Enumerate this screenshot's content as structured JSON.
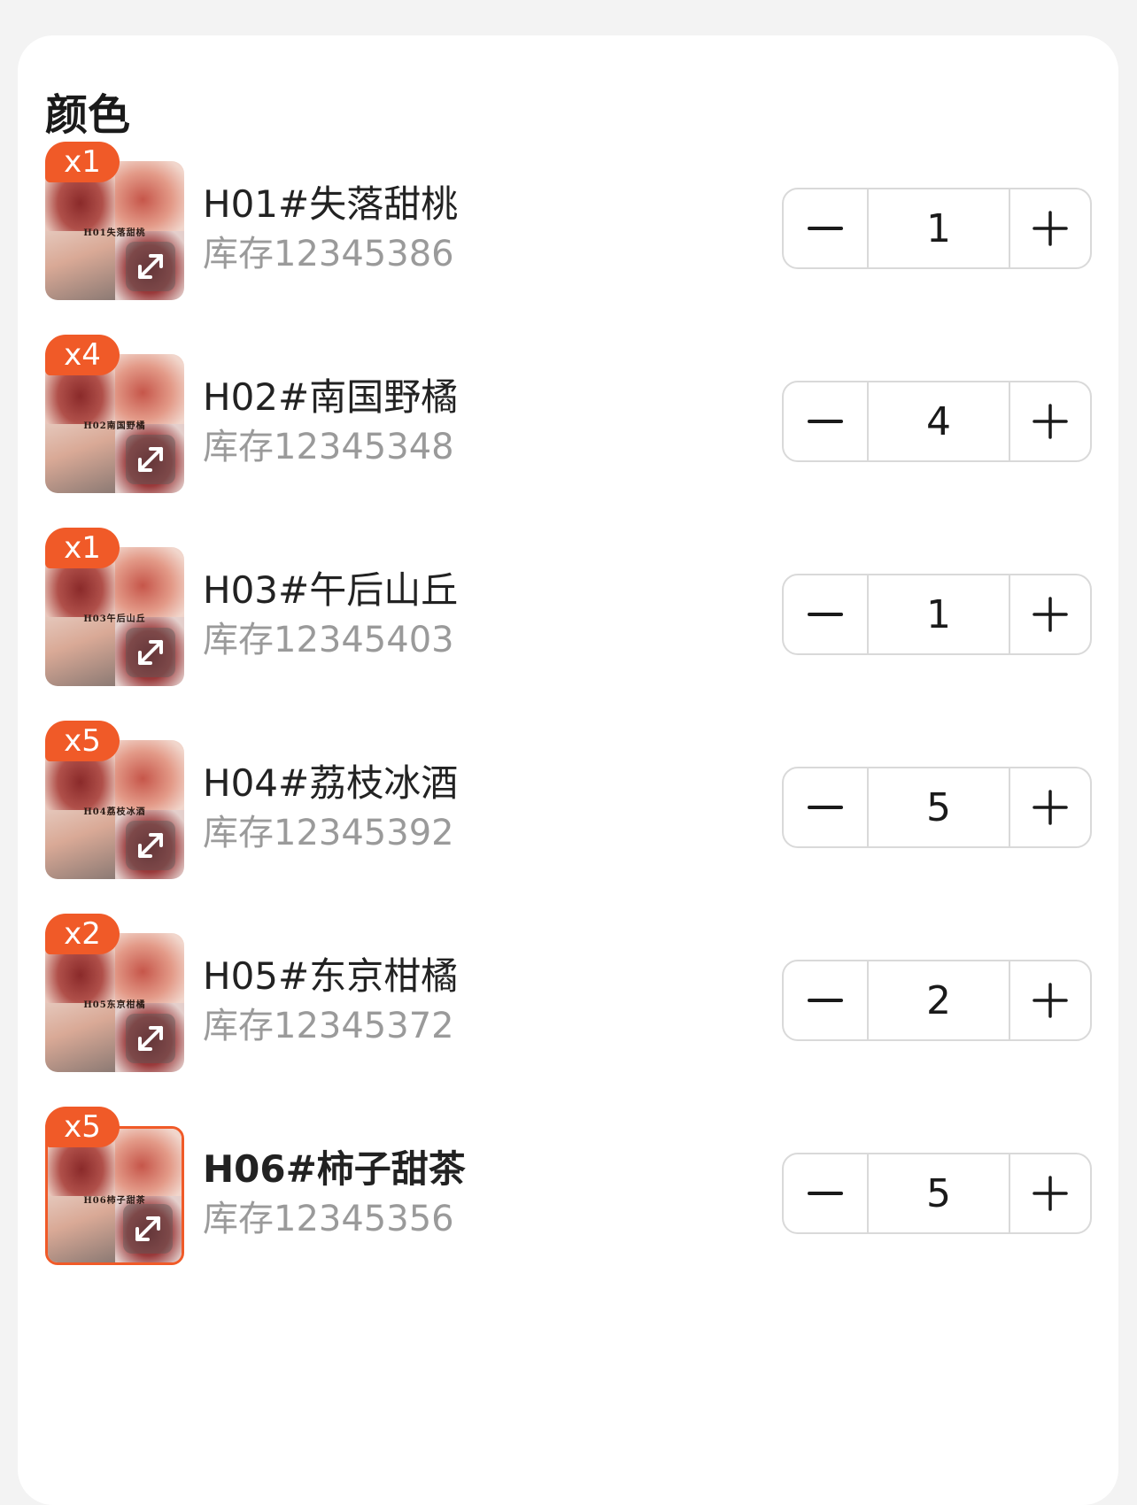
{
  "section": {
    "title": "颜色"
  },
  "items": [
    {
      "badge": "x1",
      "name": "H01#失落甜桃",
      "stock": "库存12345386",
      "quantity": "1",
      "caption": "H01失落甜桃",
      "selected": false
    },
    {
      "badge": "x4",
      "name": "H02#南国野橘",
      "stock": "库存12345348",
      "quantity": "4",
      "caption": "H02南国野橘",
      "selected": false
    },
    {
      "badge": "x1",
      "name": "H03#午后山丘",
      "stock": "库存12345403",
      "quantity": "1",
      "caption": "H03午后山丘",
      "selected": false
    },
    {
      "badge": "x5",
      "name": "H04#荔枝冰酒",
      "stock": "库存12345392",
      "quantity": "5",
      "caption": "H04荔枝冰酒",
      "selected": false
    },
    {
      "badge": "x2",
      "name": "H05#东京柑橘",
      "stock": "库存12345372",
      "quantity": "2",
      "caption": "H05东京柑橘",
      "selected": false
    },
    {
      "badge": "x5",
      "name": "H06#柿子甜茶",
      "stock": "库存12345356",
      "quantity": "5",
      "caption": "H06柿子甜茶",
      "selected": true
    }
  ],
  "colors": {
    "accent": "#f05a28",
    "stock_text": "#9a9a9a",
    "border": "#d9d9d9"
  },
  "icons": {
    "expand": "expand-arrows-icon",
    "minus": "minus-icon",
    "plus": "plus-icon"
  }
}
